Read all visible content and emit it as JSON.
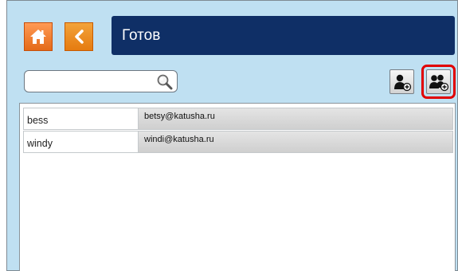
{
  "header": {
    "title": "Готов",
    "home_icon": "home-icon",
    "back_icon": "chevron-left-icon"
  },
  "search": {
    "value": "",
    "placeholder": "",
    "icon": "magnifier-icon"
  },
  "toolbar": {
    "add_user_icon": "add-user-icon",
    "add_group_icon": "add-group-icon",
    "highlighted": "add-group-button"
  },
  "list": {
    "rows": [
      {
        "name": "bess",
        "email": "betsy@katusha.ru"
      },
      {
        "name": "windy",
        "email": "windi@katusha.ru"
      }
    ]
  },
  "colors": {
    "background": "#bfe0f2",
    "title_bar": "#0f2f66",
    "accent_orange": "#e57b10",
    "highlight": "#e10000"
  }
}
